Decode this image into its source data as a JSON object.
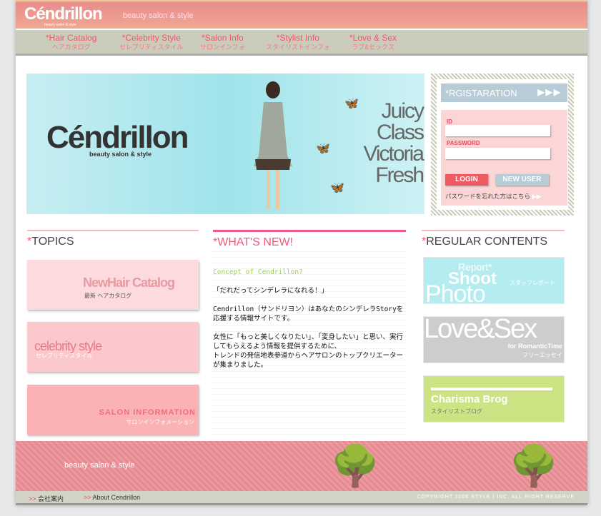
{
  "header": {
    "logo": "Céndrillon",
    "logo_sub": "beauty salon & style",
    "tagline": "beauty salon & style"
  },
  "nav": [
    {
      "en": "*Hair  Catalog",
      "ja": "ヘアカタログ"
    },
    {
      "en": "*Celebrity Style",
      "ja": "セレブリティスタイル"
    },
    {
      "en": "*Salon Info",
      "ja": "サロンインフォ"
    },
    {
      "en": "*Stylist Info",
      "ja": "スタイリストインフォ"
    },
    {
      "en": "*Love & Sex",
      "ja": "ラブ&セックス"
    }
  ],
  "hero": {
    "logo": "Céndrillon",
    "sub": "beauty salon & style",
    "words": [
      "Juicy",
      "Class",
      "Victoria",
      "Fresh"
    ]
  },
  "registration": {
    "title": "*RGISTARATION",
    "arrows": "▶▶▶",
    "id_label": "ID",
    "password_label": "PASSWORD",
    "login": "LOGIN",
    "new_user": "NEW USER",
    "forgot": "パスワードを忘れた方はこちら",
    "forgot_arrows": "▶▶"
  },
  "topics": {
    "star": "*",
    "title": "TOPICS",
    "cards": [
      {
        "title": "NewHair Catalog",
        "sub": "最新 ヘアカタログ"
      },
      {
        "title": "celebrity style",
        "sub": "セレブリティスタイル"
      },
      {
        "title": "SALON INFORMATION",
        "sub": "サロンインフォメーション"
      }
    ]
  },
  "whatsnew": {
    "title": "*WHAT'S NEW!",
    "concept": "Concept  of Cendrillon?",
    "p1": "「だれだってシンデレラになれる！」",
    "p2": "Cendrillon（サンドリヨン）はあなたのシンデレラStoryを応援する情報サイトです。",
    "p3": "女性に「もっと美しくなりたい」、「変身したい」と思い、実行してもらえるよう情報を提供するために、",
    "p4": "トレンドの発信地表参道からヘアサロンのトップクリエーターが集まりました。"
  },
  "regular": {
    "star": "*",
    "title": "REGULAR CONTENTS",
    "items": [
      {
        "l1": "Report*",
        "l2": "Shoot",
        "l3": "Photo",
        "ja": "スタッフレポート"
      },
      {
        "l1": "Love&Sex",
        "l2": "for RomanticTime",
        "ja": "フリーエッセイ"
      },
      {
        "l1": "Charisma Brog",
        "ja": "スタイリストブログ"
      }
    ]
  },
  "footer": {
    "tagline": "beauty salon & style",
    "link_arrow": ">>",
    "links": [
      "会社案内",
      "About Cendrillon"
    ],
    "copyright": "COPYRIGHT 2006 STYLE I INC. ALL RIGHT RESERVE"
  }
}
